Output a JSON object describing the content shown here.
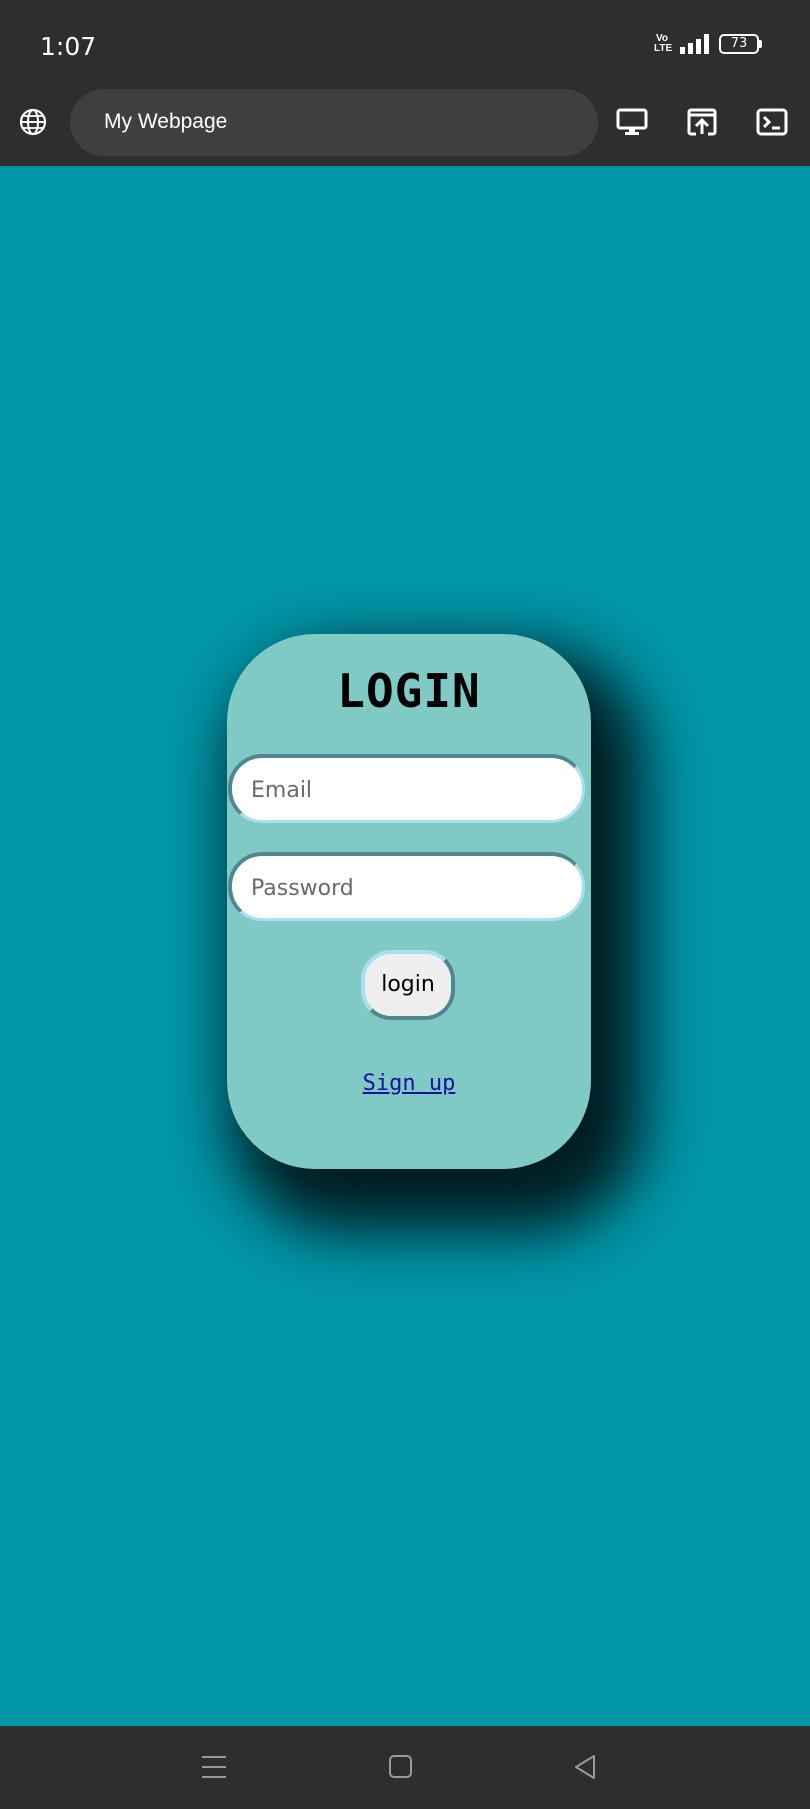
{
  "status_bar": {
    "time": "1:07",
    "volte_top": "Vo",
    "volte_bottom": "LTE",
    "battery_level": "73"
  },
  "browser": {
    "title": "My Webpage",
    "icons": [
      "globe-icon",
      "desktop-icon",
      "open-in-browser-icon",
      "terminal-icon"
    ]
  },
  "login_card": {
    "title": "LOGIN",
    "email_placeholder": "Email",
    "password_placeholder": "Password",
    "login_button": "login",
    "signup_link": "Sign up"
  },
  "nav_bar": {
    "icons": [
      "menu-icon",
      "home-icon",
      "back-icon"
    ]
  },
  "colors": {
    "page_background": "#0096a8",
    "card_background": "#80cac5",
    "system_bar": "#2e2e2e",
    "url_pill": "#3f3f3f",
    "link": "#1b0f9e"
  }
}
